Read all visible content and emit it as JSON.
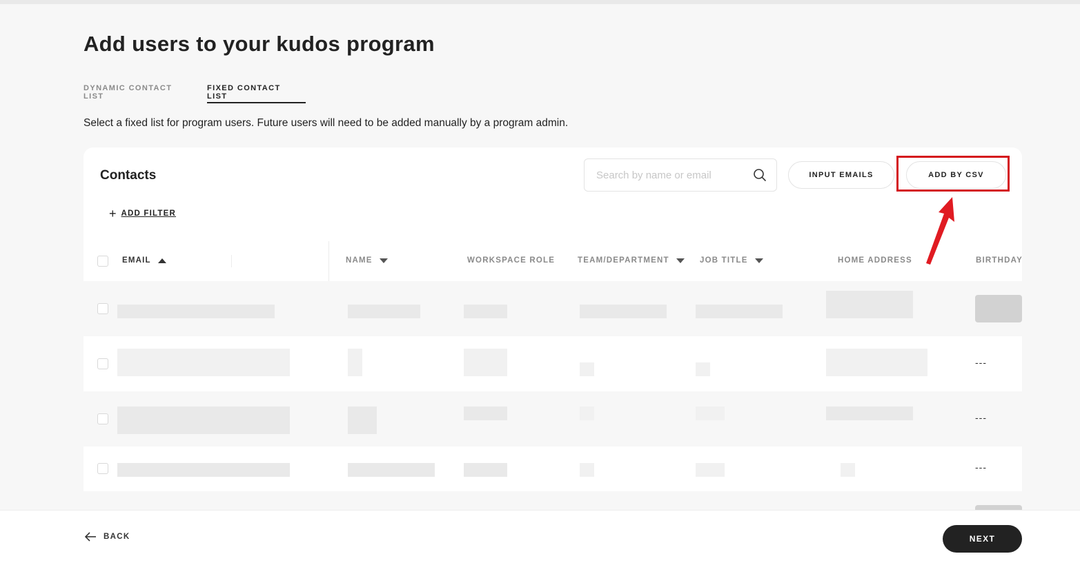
{
  "page": {
    "title": "Add users to your kudos program",
    "subtitle": "Select a fixed list for program users. Future users will need to be added manually by a program admin."
  },
  "tabs": [
    {
      "label": "DYNAMIC CONTACT LIST",
      "active": false
    },
    {
      "label": "FIXED CONTACT LIST",
      "active": true
    }
  ],
  "contacts": {
    "title": "Contacts",
    "search_placeholder": "Search by name or email",
    "input_emails_label": "INPUT EMAILS",
    "add_by_csv_label": "ADD BY CSV",
    "add_filter_label": "ADD FILTER",
    "columns": [
      {
        "label": "EMAIL",
        "sort": "asc"
      },
      {
        "label": "NAME",
        "sort": "desc"
      },
      {
        "label": "WORKSPACE ROLE",
        "sort": "none"
      },
      {
        "label": "TEAM/DEPARTMENT",
        "sort": "desc"
      },
      {
        "label": "JOB TITLE",
        "sort": "desc"
      },
      {
        "label": "HOME ADDRESS",
        "sort": "none"
      },
      {
        "label": "BIRTHDAY",
        "sort": "none"
      }
    ],
    "rows": [
      {
        "birthday": ""
      },
      {
        "birthday": "---"
      },
      {
        "birthday": "---"
      },
      {
        "birthday": "---"
      }
    ]
  },
  "footer": {
    "back_label": "BACK",
    "next_label": "NEXT"
  },
  "colors": {
    "accent_dark": "#222222",
    "highlight_red": "#d4141c",
    "background": "#f7f7f7"
  }
}
